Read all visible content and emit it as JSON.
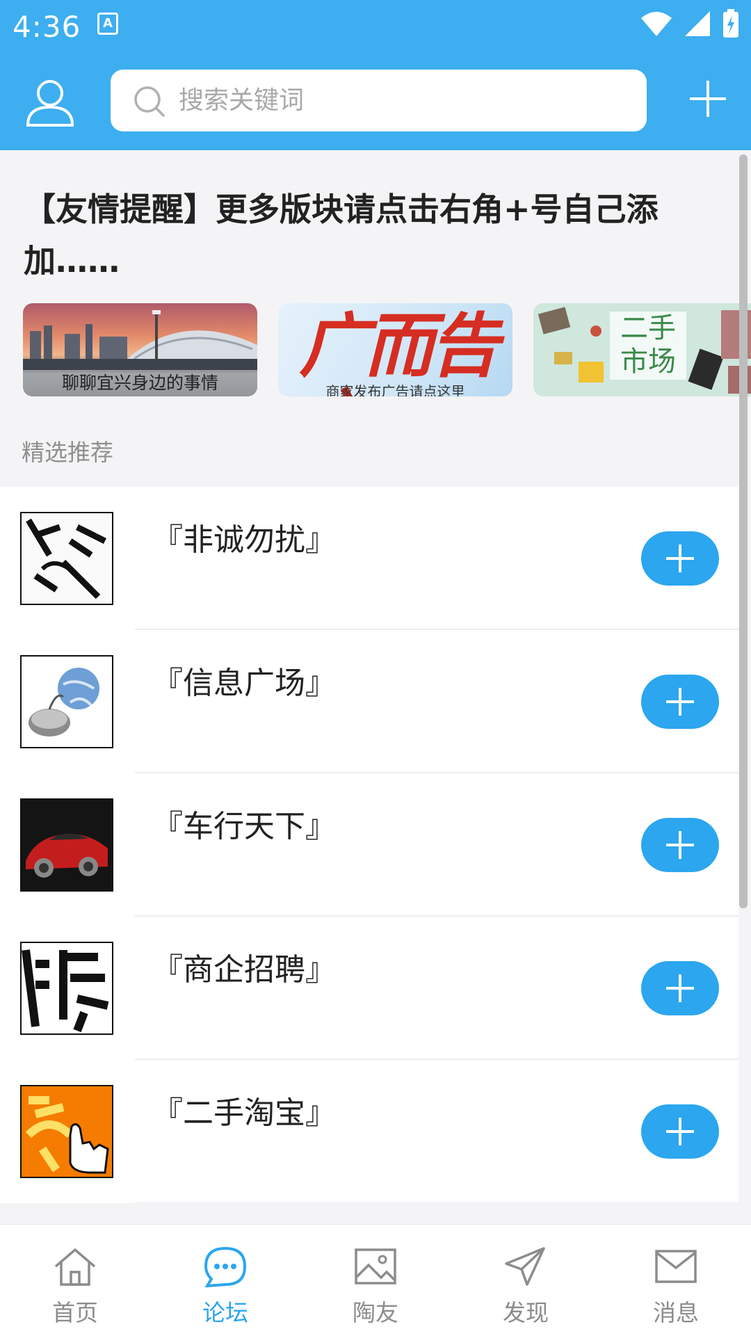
{
  "status_bar": {
    "time": "4:36",
    "notification": "A"
  },
  "header": {
    "search_placeholder": "搜索关键词"
  },
  "notice": {
    "text": "【友情提醒】更多版块请点击右角+号自己添加……"
  },
  "banners": [
    {
      "caption": "聊聊宜兴身边的事情"
    },
    {
      "title": "广而告之",
      "caption": "商家发布广告请点这里"
    },
    {
      "title": "二手市场"
    }
  ],
  "section": {
    "title": "精选推荐"
  },
  "forums": [
    {
      "title": "『非诚勿扰』"
    },
    {
      "title": "『信息广场』"
    },
    {
      "title": "『车行天下』"
    },
    {
      "title": "『商企招聘』"
    },
    {
      "title": "『二手淘宝』"
    }
  ],
  "tabs": [
    {
      "label": "首页",
      "icon": "home-icon"
    },
    {
      "label": "论坛",
      "icon": "chat-bubble-icon"
    },
    {
      "label": "陶友",
      "icon": "picture-icon"
    },
    {
      "label": "发现",
      "icon": "send-icon"
    },
    {
      "label": "消息",
      "icon": "mail-icon"
    }
  ],
  "colors": {
    "primary": "#3daef0",
    "accent": "#2ba6ef"
  }
}
